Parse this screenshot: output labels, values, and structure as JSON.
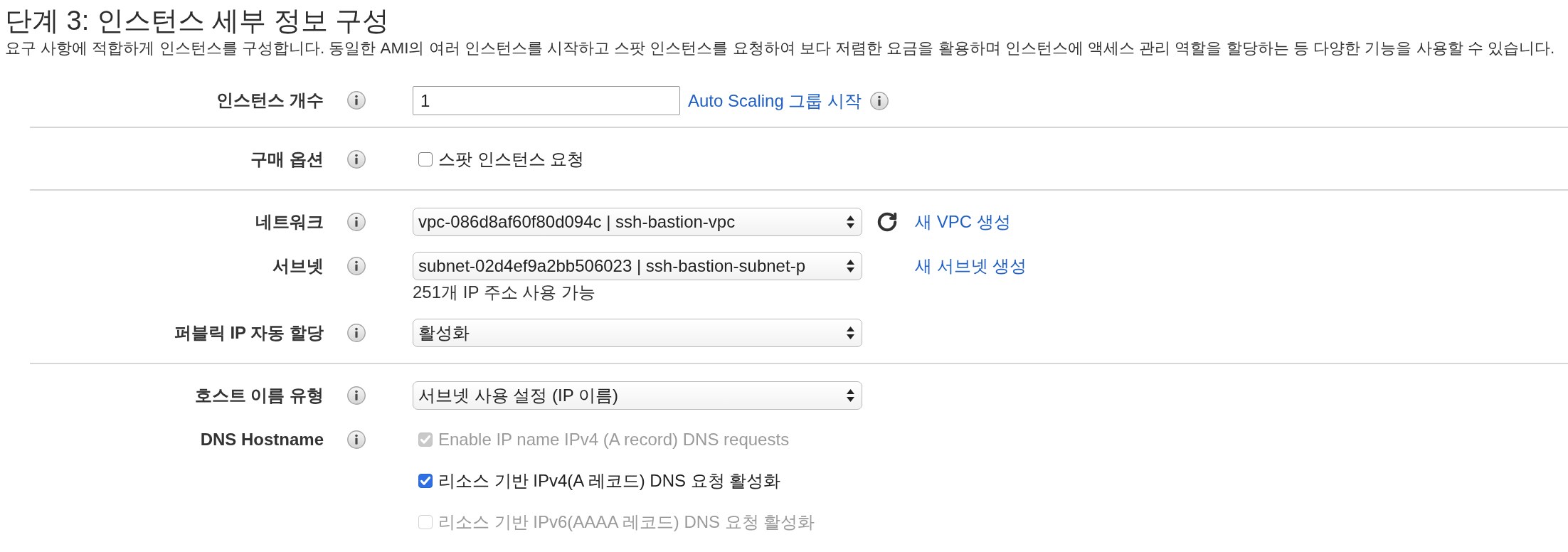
{
  "title": "단계 3: 인스턴스 세부 정보 구성",
  "description": "요구 사항에 적합하게 인스턴스를 구성합니다. 동일한 AMI의 여러 인스턴스를 시작하고 스팟 인스턴스를 요청하여 보다 저렴한 요금을 활용하며 인스턴스에 액세스 관리 역할을 할당하는 등 다양한 기능을 사용할 수 있습니다.",
  "sections": [
    {
      "rows": [
        {
          "label": "인스턴스 개수",
          "control": {
            "kind": "input",
            "value": "1"
          },
          "actions": [
            {
              "kind": "link",
              "text": "Auto Scaling 그룹 시작"
            },
            {
              "kind": "info"
            }
          ]
        }
      ]
    },
    {
      "rows": [
        {
          "label": "구매 옵션",
          "control": {
            "kind": "checkboxes",
            "options": [
              {
                "text": "스팟 인스턴스 요청",
                "checked": false,
                "disabled": false
              }
            ]
          }
        }
      ]
    },
    {
      "rows": [
        {
          "label": "네트워크",
          "control": {
            "kind": "select",
            "value": "vpc-086d8af60f80d094c | ssh-bastion-vpc"
          },
          "actions": [
            {
              "kind": "refresh"
            },
            {
              "kind": "link",
              "text": "새 VPC 생성"
            }
          ]
        },
        {
          "label": "서브넷",
          "control": {
            "kind": "select",
            "value": "subnet-02d4ef9a2bb506023 | ssh-bastion-subnet-p"
          },
          "note": "251개 IP 주소 사용 가능",
          "actions": [
            {
              "kind": "link",
              "text": "새 서브넷 생성"
            }
          ]
        },
        {
          "label": "퍼블릭 IP 자동 할당",
          "control": {
            "kind": "select",
            "value": "활성화"
          }
        }
      ]
    },
    {
      "rows": [
        {
          "label": "호스트 이름 유형",
          "control": {
            "kind": "select",
            "value": "서브넷 사용 설정 (IP 이름)"
          }
        },
        {
          "label": "DNS Hostname",
          "control": {
            "kind": "checkboxes",
            "options": [
              {
                "text": "Enable IP name IPv4 (A record) DNS requests",
                "checked": true,
                "disabled": true
              },
              {
                "text": "리소스 기반 IPv4(A 레코드) DNS 요청 활성화",
                "checked": true,
                "disabled": false
              },
              {
                "text": "리소스 기반 IPv6(AAAA 레코드) DNS 요청 활성화",
                "checked": false,
                "disabled": true
              }
            ]
          }
        }
      ]
    }
  ]
}
